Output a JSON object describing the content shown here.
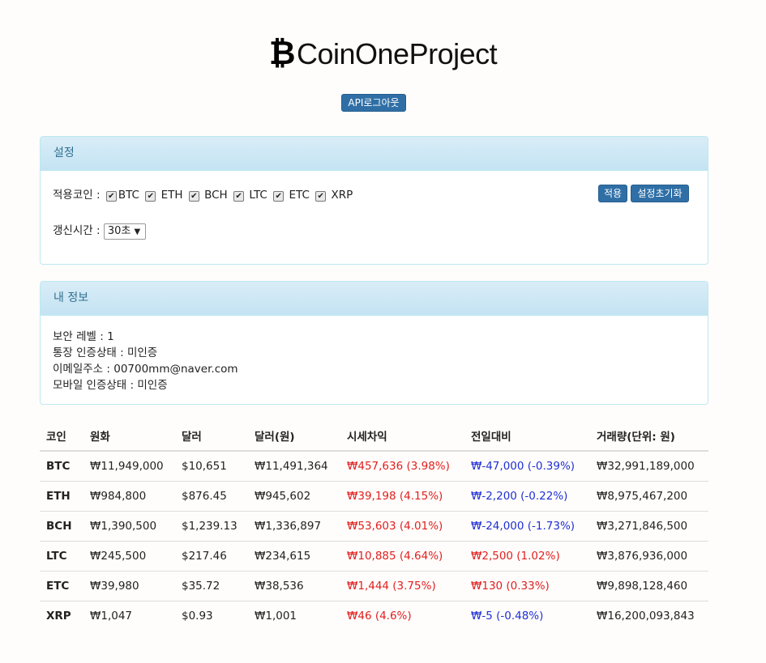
{
  "header": {
    "logo_glyph": "₿",
    "title": "CoinOneProject",
    "logout_label": "API로그아웃"
  },
  "settings": {
    "heading": "설정",
    "coins_label": "적용코인 :",
    "coins": [
      "BTC",
      "ETH",
      "BCH",
      "LTC",
      "ETC",
      "XRP"
    ],
    "apply_label": "적용",
    "reset_label": "설정초기화",
    "refresh_label": "갱신시간 :",
    "refresh_value": "30초"
  },
  "myinfo": {
    "heading": "내 정보",
    "security_level": "보안 레벨 : 1",
    "bank_status": "통장 인증상태 : 미인증",
    "email": "이메일주소 : 00700mm@naver.com",
    "mobile_status": "모바일 인증상태 : 미인증"
  },
  "table": {
    "columns": [
      "코인",
      "원화",
      "달러",
      "달러(원)",
      "시세차익",
      "전일대비",
      "거래량(단위: 원)"
    ],
    "rows": [
      {
        "coin": "BTC",
        "krw": "₩11,949,000",
        "usd": "$10,651",
        "usd_krw": "₩11,491,364",
        "premium": "₩457,636 (3.98%)",
        "premium_dir": "up",
        "change": "₩-47,000 (-0.39%)",
        "change_dir": "down",
        "volume": "₩32,991,189,000"
      },
      {
        "coin": "ETH",
        "krw": "₩984,800",
        "usd": "$876.45",
        "usd_krw": "₩945,602",
        "premium": "₩39,198 (4.15%)",
        "premium_dir": "up",
        "change": "₩-2,200 (-0.22%)",
        "change_dir": "down",
        "volume": "₩8,975,467,200"
      },
      {
        "coin": "BCH",
        "krw": "₩1,390,500",
        "usd": "$1,239.13",
        "usd_krw": "₩1,336,897",
        "premium": "₩53,603 (4.01%)",
        "premium_dir": "up",
        "change": "₩-24,000 (-1.73%)",
        "change_dir": "down",
        "volume": "₩3,271,846,500"
      },
      {
        "coin": "LTC",
        "krw": "₩245,500",
        "usd": "$217.46",
        "usd_krw": "₩234,615",
        "premium": "₩10,885 (4.64%)",
        "premium_dir": "up",
        "change": "₩2,500 (1.02%)",
        "change_dir": "up",
        "volume": "₩3,876,936,000"
      },
      {
        "coin": "ETC",
        "krw": "₩39,980",
        "usd": "$35.72",
        "usd_krw": "₩38,536",
        "premium": "₩1,444 (3.75%)",
        "premium_dir": "up",
        "change": "₩130 (0.33%)",
        "change_dir": "up",
        "volume": "₩9,898,128,460"
      },
      {
        "coin": "XRP",
        "krw": "₩1,047",
        "usd": "$0.93",
        "usd_krw": "₩1,001",
        "premium": "₩46 (4.6%)",
        "premium_dir": "up",
        "change": "₩-5 (-0.48%)",
        "change_dir": "down",
        "volume": "₩16,200,093,843"
      }
    ]
  },
  "colors": {
    "up": "#e02020",
    "down": "#1f2fd6",
    "button": "#2f6fa6"
  }
}
